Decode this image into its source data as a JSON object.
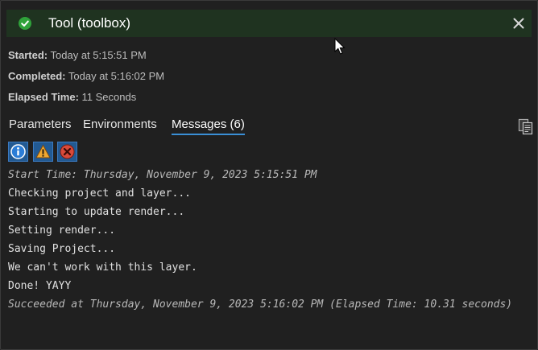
{
  "header": {
    "title": "Tool (toolbox)",
    "status_icon": "check-circle-icon",
    "status_color": "#2fa23a",
    "background": "#1f3320"
  },
  "info": {
    "started_label": "Started:",
    "started_value": "Today at 5:15:51 PM",
    "completed_label": "Completed:",
    "completed_value": "Today at 5:16:02 PM",
    "elapsed_label": "Elapsed Time:",
    "elapsed_value": "11 Seconds"
  },
  "tabs": [
    {
      "label": "Parameters",
      "active": false
    },
    {
      "label": "Environments",
      "active": false
    },
    {
      "label": "Messages (6)",
      "active": true
    }
  ],
  "filters": [
    {
      "icon": "info-icon"
    },
    {
      "icon": "warning-icon"
    },
    {
      "icon": "error-icon"
    }
  ],
  "messages": [
    {
      "text": "Start Time: Thursday, November 9, 2023 5:15:51 PM",
      "style": "italic"
    },
    {
      "text": "Checking project and layer...",
      "style": "normal"
    },
    {
      "text": "Starting to update render...",
      "style": "normal"
    },
    {
      "text": "Setting render...",
      "style": "normal"
    },
    {
      "text": "Saving Project...",
      "style": "normal"
    },
    {
      "text": "We can't work with this layer.",
      "style": "normal"
    },
    {
      "text": "Done! YAYY",
      "style": "normal"
    },
    {
      "text": "Succeeded at Thursday, November 9, 2023 5:16:02 PM (Elapsed Time: 10.31 seconds)",
      "style": "italic"
    }
  ],
  "colors": {
    "accent": "#3a8fd6",
    "filter_button": "#225a93"
  }
}
